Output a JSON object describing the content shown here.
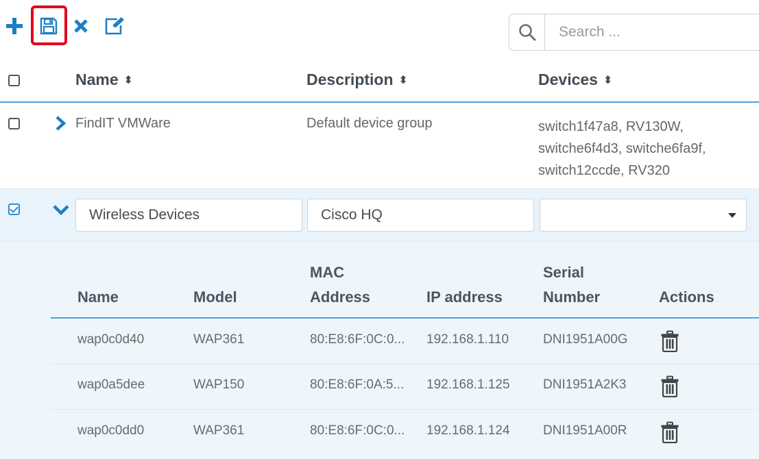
{
  "toolbar": {
    "search_placeholder": "Search ..."
  },
  "table": {
    "headers": {
      "name": "Name",
      "description": "Description",
      "devices": "Devices"
    },
    "rows": [
      {
        "name": "FindIT VMWare",
        "description": "Default device group",
        "devices_line1": "switch1f47a8, RV130W,",
        "devices_line2": "switche6f4d3, switche6fa9f,",
        "devices_line3": "switch12ccde, RV320"
      }
    ],
    "editing_row": {
      "name_value": "Wireless Devices",
      "description_value": "Cisco HQ",
      "devices_value": ""
    }
  },
  "subtable": {
    "headers": {
      "name": "Name",
      "model": "Model",
      "mac_line1": "MAC",
      "mac_line2": "Address",
      "ip": "IP address",
      "serial_line1": "Serial",
      "serial_line2": "Number",
      "actions": "Actions"
    },
    "rows": [
      {
        "name": "wap0c0d40",
        "model": "WAP361",
        "mac": "80:E8:6F:0C:0...",
        "ip": "192.168.1.110",
        "serial": "DNI1951A00G"
      },
      {
        "name": "wap0a5dee",
        "model": "WAP150",
        "mac": "80:E8:6F:0A:5...",
        "ip": "192.168.1.125",
        "serial": "DNI1951A2K3"
      },
      {
        "name": "wap0c0dd0",
        "model": "WAP361",
        "mac": "80:E8:6F:0C:0...",
        "ip": "192.168.1.124",
        "serial": "DNI1951A00R"
      }
    ]
  },
  "colors": {
    "accent": "#1e7fc2",
    "highlight": "#e3001b",
    "expanded_bg": "#eef6fc"
  },
  "icons": {
    "add": "plus-icon",
    "save": "save-icon",
    "delete": "close-icon",
    "edit": "edit-icon",
    "search": "search-icon",
    "expand": "chevron-right-icon",
    "collapse": "chevron-down-icon",
    "row_delete": "trash-icon"
  }
}
